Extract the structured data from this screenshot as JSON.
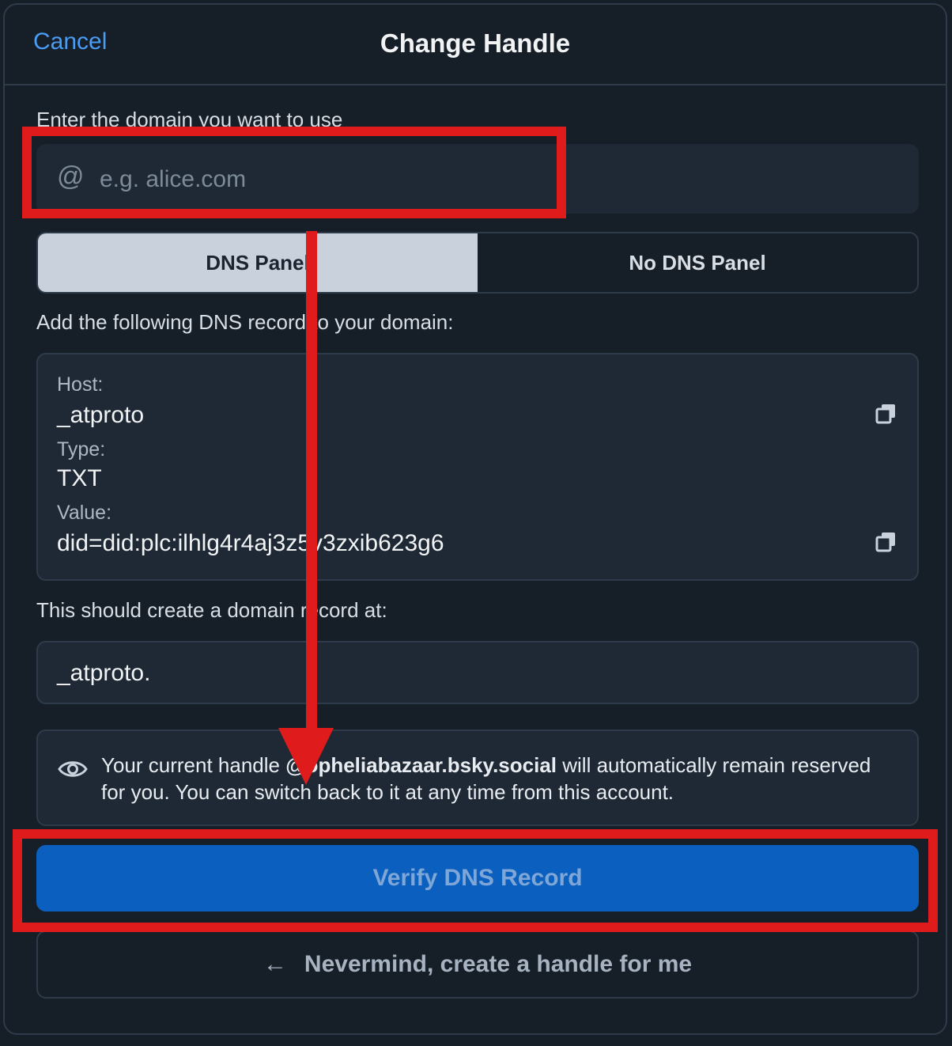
{
  "header": {
    "cancel_label": "Cancel",
    "title": "Change Handle"
  },
  "domain_input": {
    "label": "Enter the domain you want to use",
    "at_symbol": "@",
    "placeholder": "e.g. alice.com",
    "value": ""
  },
  "tabs": [
    {
      "label": "DNS Panel",
      "active": true
    },
    {
      "label": "No DNS Panel",
      "active": false
    }
  ],
  "instructions": "Add the following DNS record to your domain:",
  "dns_record": {
    "host_label": "Host:",
    "host_value": "_atproto",
    "type_label": "Type:",
    "type_value": "TXT",
    "value_label": "Value:",
    "value_value": "did=did:plc:ilhlg4r4aj3z5v3zxib623g6",
    "copy_icon": "copy-icon"
  },
  "domain_record": {
    "label": "This should create a domain record at:",
    "value": "_atproto."
  },
  "notice": {
    "icon": "eye-icon",
    "prefix": "Your current handle ",
    "handle": "@opheliabazaar.bsky.social",
    "suffix": " will automatically remain reserved for you. You can switch back to it at any time from this account."
  },
  "buttons": {
    "verify_label": "Verify DNS Record",
    "nevermind_arrow": "←",
    "nevermind_label": "Nevermind, create a handle for me"
  },
  "colors": {
    "background": "#161e27",
    "accent": "#0b5fbf",
    "link": "#4a9cf5",
    "annotation": "#e01b1b"
  }
}
